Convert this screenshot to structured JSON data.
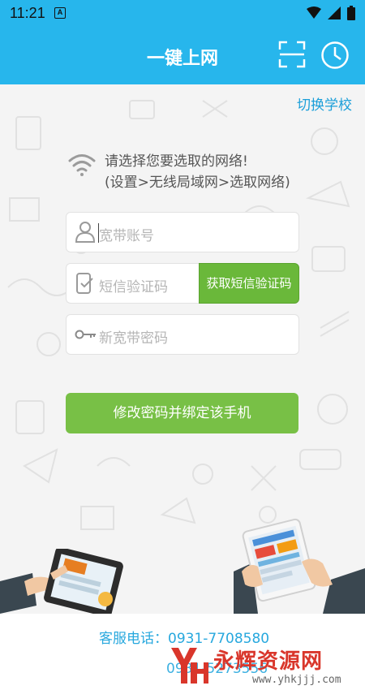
{
  "status_bar": {
    "time": "11:21",
    "notification_letter": "A"
  },
  "app_bar": {
    "title": "一键上网",
    "scan_icon": "scan-icon",
    "history_icon": "clock-icon"
  },
  "switch_school": "切换学校",
  "hint": {
    "line1": "请选择您要选取的网络!",
    "line2": "(设置>无线局域网>选取网络)"
  },
  "form": {
    "account_placeholder": "宽带账号",
    "sms_placeholder": "短信验证码",
    "sms_button": "获取短信验证码",
    "password_placeholder": "新宽带密码",
    "submit_button": "修改密码并绑定该手机"
  },
  "footer": {
    "phone1": "客服电话：0931-7708580",
    "phone2": "0931-5273556"
  },
  "watermark": {
    "text": "永辉资源网",
    "url": "www.yhkjjj.com"
  },
  "colors": {
    "primary": "#27b6ec",
    "green": "#6ab83a",
    "link": "#1b9fd9",
    "watermark_red": "#d9362b"
  }
}
